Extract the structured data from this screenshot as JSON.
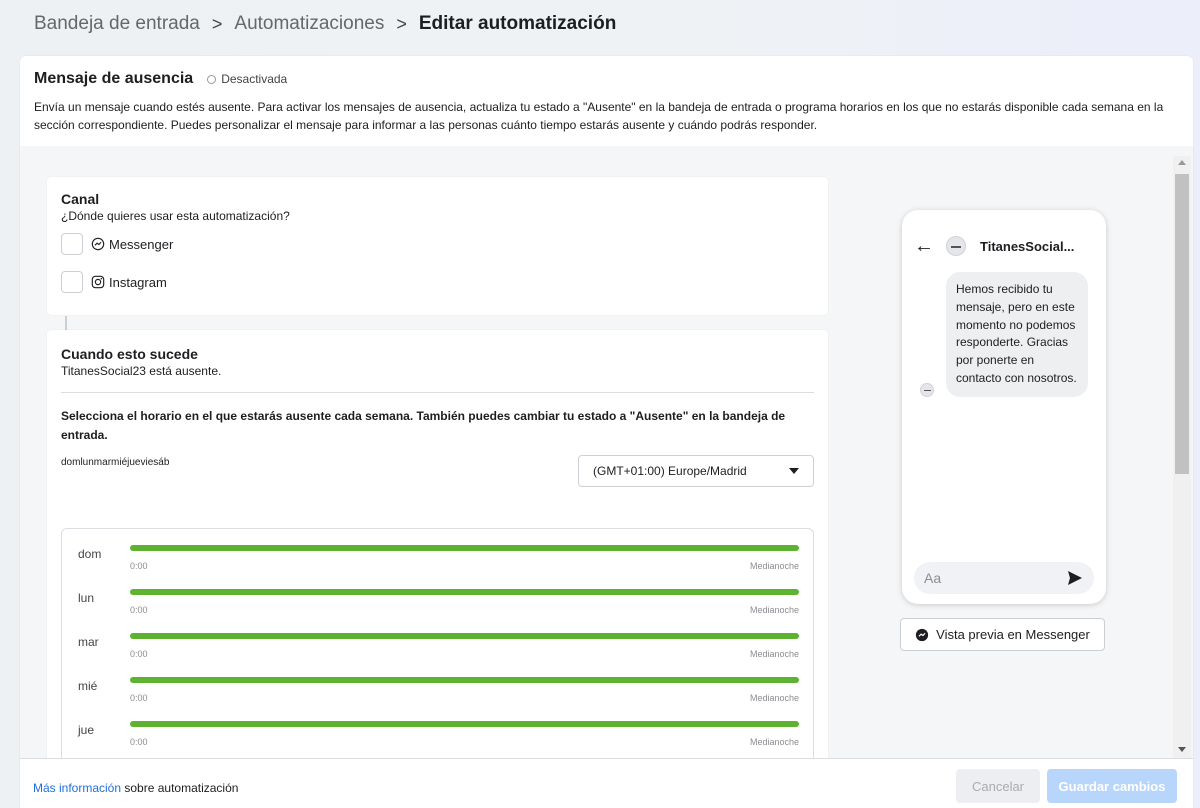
{
  "breadcrumb": {
    "items": [
      "Bandeja de entrada",
      "Automatizaciones",
      "Editar automatización"
    ],
    "separator": ">"
  },
  "header": {
    "title": "Mensaje de ausencia",
    "status": "Desactivada",
    "description": "Envía un mensaje cuando estés ausente. Para activar los mensajes de ausencia, actualiza tu estado a \"Ausente\" en la bandeja de entrada o programa horarios en los que no estarás disponible cada semana en la sección correspondiente. Puedes personalizar el mensaje para informar a las personas cuánto tiempo estarás ausente y cuándo podrás responder."
  },
  "canal": {
    "title": "Canal",
    "question": "¿Dónde quieres usar esta automatización?",
    "channels": [
      {
        "label": "Messenger",
        "icon": "messenger-icon",
        "checked": false
      },
      {
        "label": "Instagram",
        "icon": "instagram-icon",
        "checked": false
      }
    ]
  },
  "when": {
    "title": "Cuando esto sucede",
    "subtitle": "TitanesSocial23 está ausente.",
    "schedule_question": "Selecciona el horario en el que estarás ausente cada semana. También puedes cambiar tu estado a \"Ausente\" en la bandeja de entrada.",
    "days_inline": "domlunmarmiéjueviesáb",
    "timezone": "(GMT+01:00) Europe/Madrid",
    "schedule": [
      {
        "day": "dom",
        "start": "0:00",
        "end": "Medianoche"
      },
      {
        "day": "lun",
        "start": "0:00",
        "end": "Medianoche"
      },
      {
        "day": "mar",
        "start": "0:00",
        "end": "Medianoche"
      },
      {
        "day": "mié",
        "start": "0:00",
        "end": "Medianoche"
      },
      {
        "day": "jue",
        "start": "0:00",
        "end": "Medianoche"
      }
    ]
  },
  "preview": {
    "page_name": "TitanesSocial...",
    "message": "Hemos recibido tu mensaje, pero en este momento no podemos responderte. Gracias por ponerte en contacto con nosotros.",
    "composer_placeholder": "Aa",
    "preview_button": "Vista previa en Messenger"
  },
  "footer": {
    "link_text": "Más información",
    "info_suffix": " sobre automatización",
    "cancel_label": "Cancelar",
    "save_label": "Guardar cambios"
  },
  "colors": {
    "schedule_bar": "#5db22f",
    "link": "#216fdb",
    "save_disabled": "#b8d6fb"
  }
}
